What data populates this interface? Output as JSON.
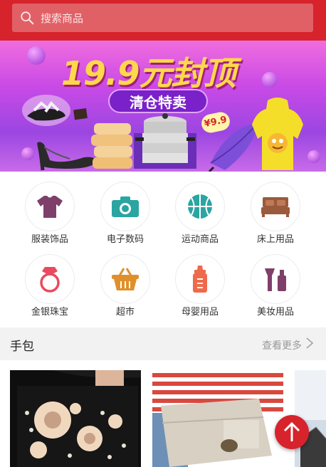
{
  "search": {
    "placeholder": "搜索商品"
  },
  "banner": {
    "headline": "19.9元封顶",
    "subtitle": "清仓特卖",
    "price_tag": "¥9.9"
  },
  "categories": [
    {
      "label": "服装饰品",
      "icon": "tshirt-icon",
      "color": "#7f3f6b"
    },
    {
      "label": "电子数码",
      "icon": "camera-icon",
      "color": "#2aa5a2"
    },
    {
      "label": "运动商品",
      "icon": "basketball-icon",
      "color": "#2aa5a2"
    },
    {
      "label": "床上用品",
      "icon": "bed-icon",
      "color": "#9a5a3c"
    },
    {
      "label": "金银珠宝",
      "icon": "ring-icon",
      "color": "#e84a5f"
    },
    {
      "label": "超市",
      "icon": "basket-icon",
      "color": "#e0902a"
    },
    {
      "label": "母婴用品",
      "icon": "baby-bottle-icon",
      "color": "#ef6a4b"
    },
    {
      "label": "美妆用品",
      "icon": "cosmetics-icon",
      "color": "#7f3f6b"
    }
  ],
  "section": {
    "title": "手包",
    "more": "查看更多"
  },
  "colors": {
    "brand": "#d6232c",
    "section_bg": "#f2f2f2"
  }
}
